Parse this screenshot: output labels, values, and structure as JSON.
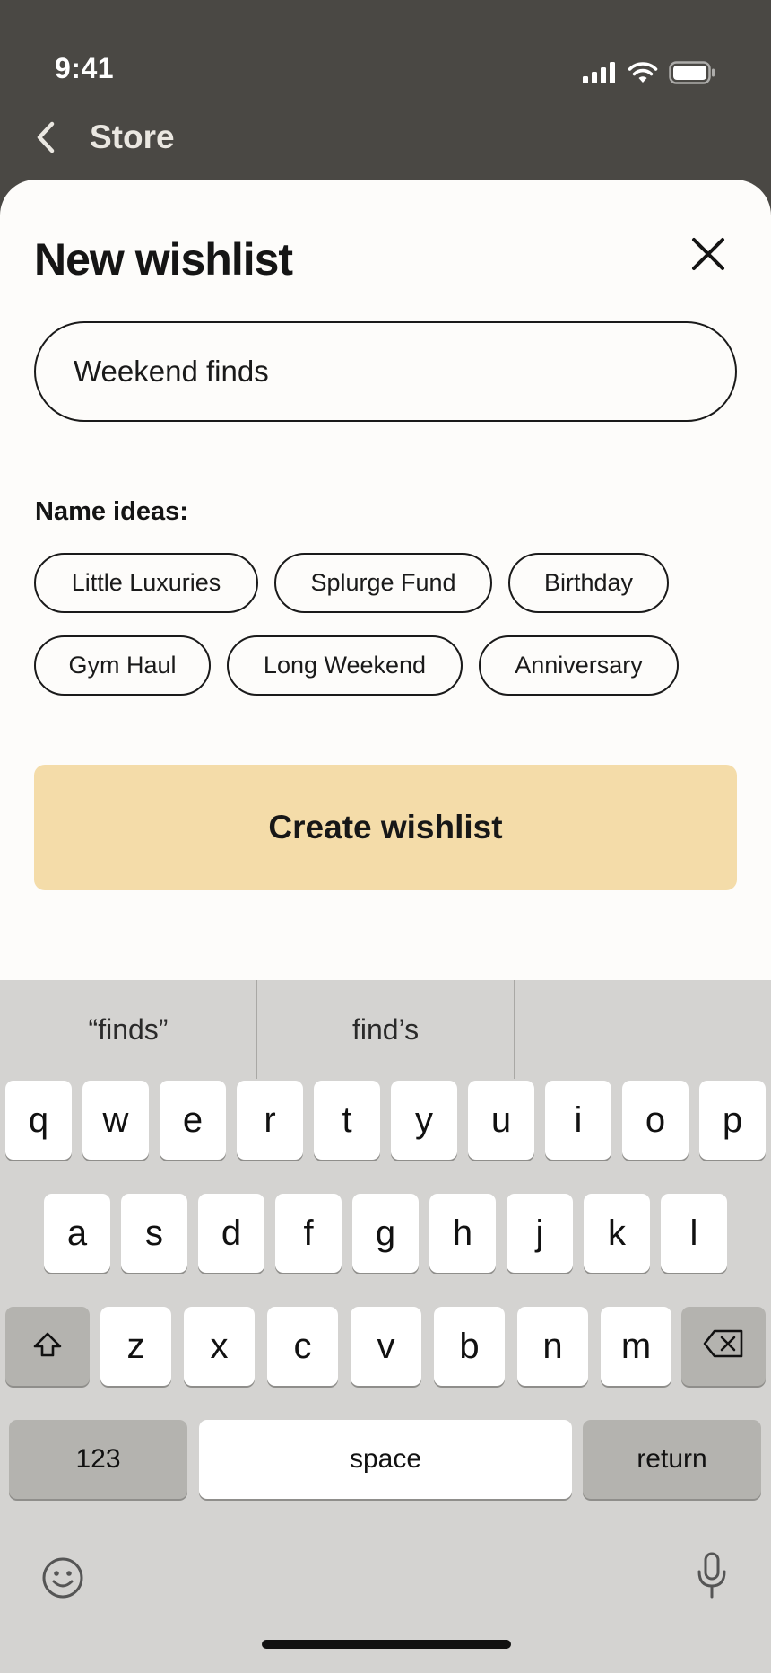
{
  "status_bar": {
    "time": "9:41"
  },
  "nav": {
    "back_label": "Store"
  },
  "sheet": {
    "title": "New wishlist",
    "input_value": "Weekend finds",
    "ideas_label": "Name ideas:",
    "ideas_row1": [
      "Little Luxuries",
      "Splurge Fund",
      "Birthday"
    ],
    "ideas_row2": [
      "Gym Haul",
      "Long Weekend",
      "Anniversary"
    ],
    "create_label": "Create wishlist"
  },
  "keyboard": {
    "suggestions": [
      "“finds”",
      "find’s",
      ""
    ],
    "row1": [
      "q",
      "w",
      "e",
      "r",
      "t",
      "y",
      "u",
      "i",
      "o",
      "p"
    ],
    "row2": [
      "a",
      "s",
      "d",
      "f",
      "g",
      "h",
      "j",
      "k",
      "l"
    ],
    "row3": [
      "z",
      "x",
      "c",
      "v",
      "b",
      "n",
      "m"
    ],
    "numbers_label": "123",
    "space_label": "space",
    "return_label": "return"
  },
  "colors": {
    "accent_button": "#f4dca9",
    "background_dim": "#4a4844",
    "sheet": "#fdfcfa",
    "keyboard": "#d4d3d1"
  },
  "icons": [
    "signal-icon",
    "wifi-icon",
    "battery-icon",
    "chevron-left-icon",
    "close-icon",
    "shift-icon",
    "backspace-icon",
    "emoji-icon",
    "microphone-icon"
  ]
}
